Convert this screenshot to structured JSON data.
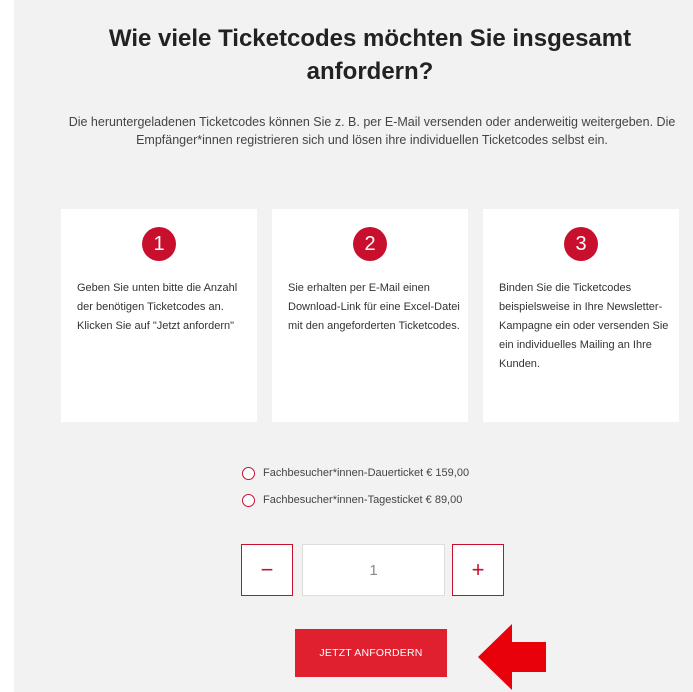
{
  "header": {
    "title_line1": "Wie viele Ticketcodes möchten Sie insgesamt",
    "title_line2": "anfordern?",
    "intro": "Die heruntergeladenen Ticketcodes können Sie z. B. per E-Mail versenden oder anderweitig weitergeben. Die Empfänger*innen registrieren sich und lösen ihre individuellen Ticketcodes selbst ein."
  },
  "steps": [
    {
      "number": "1",
      "text": "Geben Sie unten bitte die Anzahl der benötigen Ticketcodes an. Klicken Sie auf \"Jetzt anfordern\""
    },
    {
      "number": "2",
      "text": "Sie erhalten per E-Mail einen Download-Link für eine Excel-Datei mit den angeforderten Ticketcodes."
    },
    {
      "number": "3",
      "text": "Binden Sie die Ticketcodes beispielsweise in Ihre Newsletter-Kampagne ein oder versenden Sie ein individuelles Mailing an Ihre Kunden."
    }
  ],
  "ticket_options": [
    {
      "label": "Fachbesucher*innen-Dauerticket € 159,00",
      "selected": false
    },
    {
      "label": "Fachbesucher*innen-Tagesticket € 89,00",
      "selected": false
    }
  ],
  "quantity": {
    "minus_label": "−",
    "plus_label": "+",
    "value": "1"
  },
  "submit_label": "JETZT ANFORDERN",
  "colors": {
    "accent": "#c8102e",
    "button": "#e0202e",
    "panel_background": "#f2f2f2",
    "arrow": "#e8000b"
  }
}
